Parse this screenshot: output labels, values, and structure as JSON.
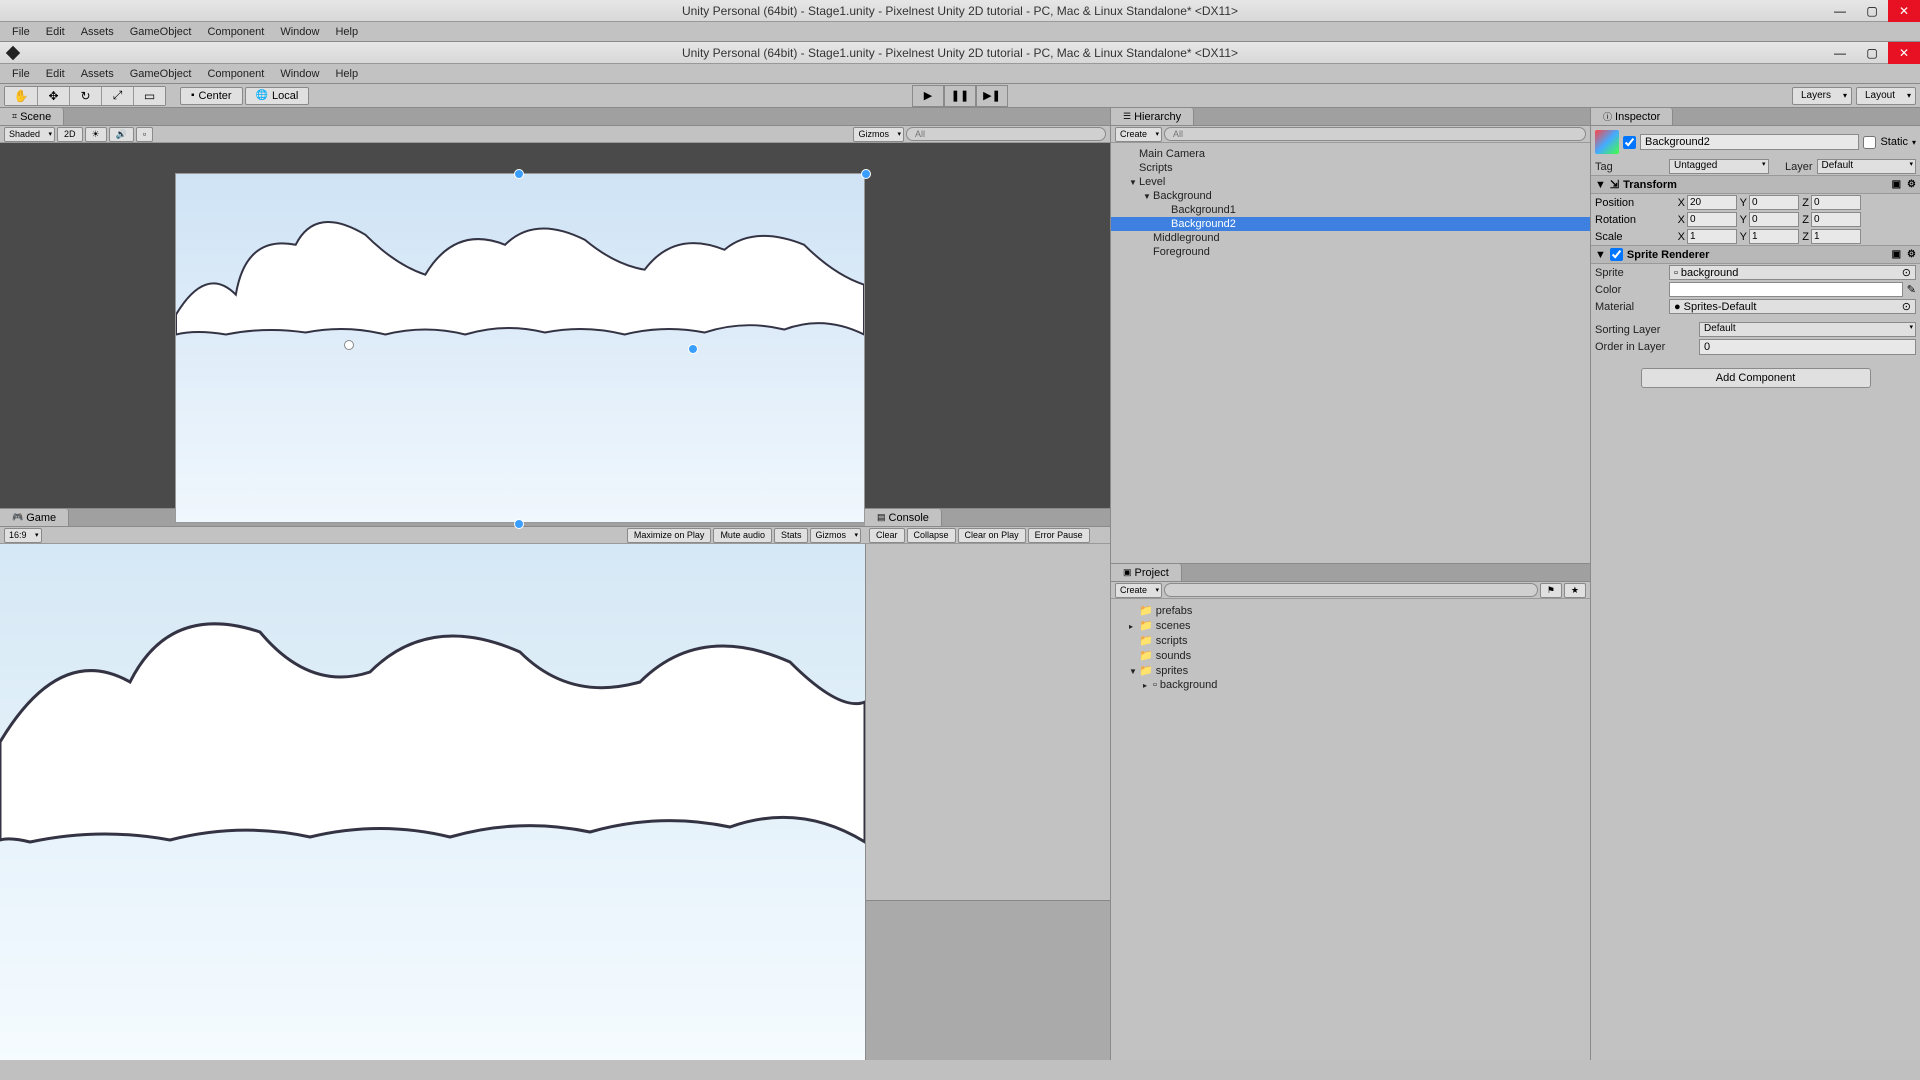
{
  "window": {
    "title": "Unity Personal (64bit) - Stage1.unity - Pixelnest Unity 2D tutorial - PC, Mac & Linux Standalone* <DX11>"
  },
  "menu": [
    "File",
    "Edit",
    "Assets",
    "GameObject",
    "Component",
    "Window",
    "Help"
  ],
  "toolbar": {
    "center_btn": "Center",
    "local_btn": "Local",
    "layers": "Layers",
    "layout": "Layout"
  },
  "scene": {
    "tab": "Scene",
    "shading": "Shaded",
    "mode2d": "2D",
    "gizmos": "Gizmos",
    "search_ph": "All"
  },
  "game": {
    "tab": "Game",
    "aspect": "16:9",
    "maximize": "Maximize on Play",
    "mute": "Mute audio",
    "stats": "Stats",
    "gizmos": "Gizmos"
  },
  "console": {
    "tab": "Console",
    "clear": "Clear",
    "collapse": "Collapse",
    "clear_on_play": "Clear on Play",
    "error_pause": "Error Pause"
  },
  "hierarchy": {
    "tab": "Hierarchy",
    "create": "Create",
    "search_ph": "All",
    "items": [
      {
        "label": "Main Camera",
        "depth": 0
      },
      {
        "label": "Scripts",
        "depth": 0
      },
      {
        "label": "Level",
        "depth": 0,
        "arrow": "▼"
      },
      {
        "label": "Background",
        "depth": 1,
        "arrow": "▼"
      },
      {
        "label": "Background1",
        "depth": 2
      },
      {
        "label": "Background2",
        "depth": 2,
        "selected": true
      },
      {
        "label": "Middleground",
        "depth": 1
      },
      {
        "label": "Foreground",
        "depth": 1
      }
    ]
  },
  "project": {
    "tab": "Project",
    "create": "Create",
    "items": [
      {
        "label": "prefabs",
        "depth": 0,
        "icon": "📁"
      },
      {
        "label": "scenes",
        "depth": 0,
        "icon": "📁",
        "arrow": "▸"
      },
      {
        "label": "scripts",
        "depth": 0,
        "icon": "📁"
      },
      {
        "label": "sounds",
        "depth": 0,
        "icon": "📁"
      },
      {
        "label": "sprites",
        "depth": 0,
        "icon": "📁",
        "arrow": "▼"
      },
      {
        "label": "background",
        "depth": 1,
        "icon": "▫",
        "arrow": "▸"
      }
    ]
  },
  "inspector": {
    "tab": "Inspector",
    "name": "Background2",
    "static_lbl": "Static",
    "tag_lbl": "Tag",
    "tag_val": "Untagged",
    "layer_lbl": "Layer",
    "layer_val": "Default",
    "transform": {
      "title": "Transform",
      "position_lbl": "Position",
      "pos": {
        "x": "20",
        "y": "0",
        "z": "0"
      },
      "rotation_lbl": "Rotation",
      "rot": {
        "x": "0",
        "y": "0",
        "z": "0"
      },
      "scale_lbl": "Scale",
      "scl": {
        "x": "1",
        "y": "1",
        "z": "1"
      }
    },
    "sprite_renderer": {
      "title": "Sprite Renderer",
      "sprite_lbl": "Sprite",
      "sprite_val": "background",
      "color_lbl": "Color",
      "material_lbl": "Material",
      "material_val": "Sprites-Default",
      "sorting_layer_lbl": "Sorting Layer",
      "sorting_layer_val": "Default",
      "order_lbl": "Order in Layer",
      "order_val": "0"
    },
    "add_component": "Add Component"
  }
}
